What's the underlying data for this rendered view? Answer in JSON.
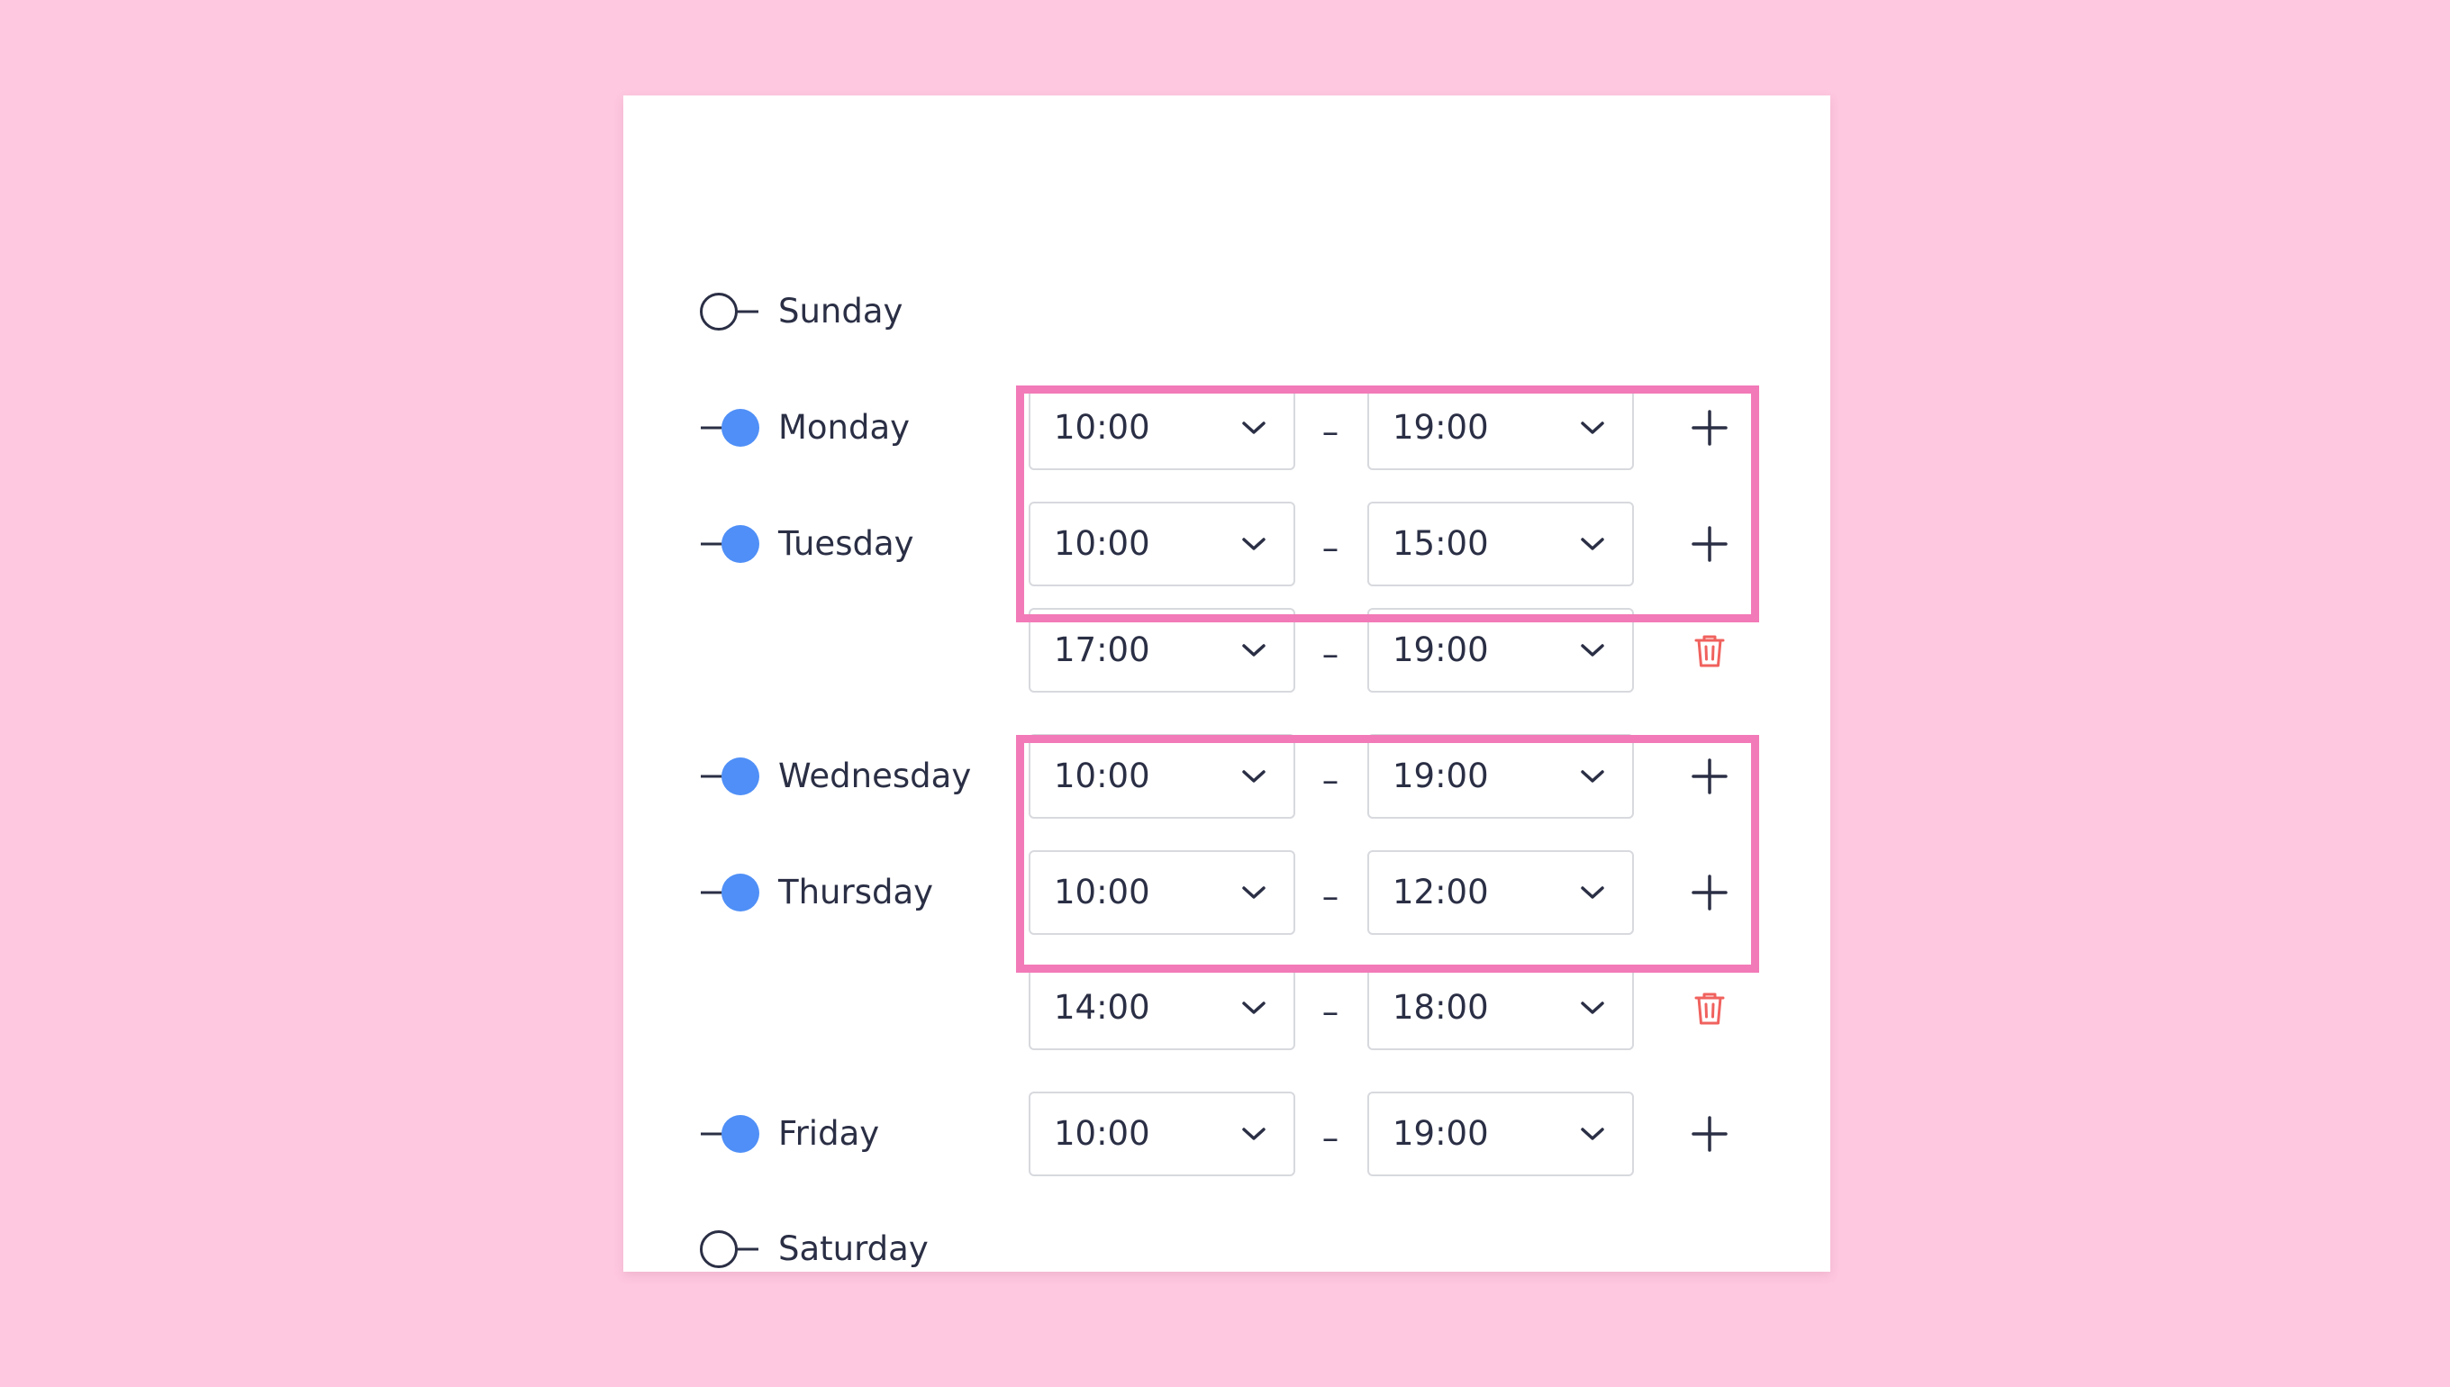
{
  "schedule": {
    "days": [
      {
        "label": "Sunday",
        "enabled": false,
        "slots": []
      },
      {
        "label": "Monday",
        "enabled": true,
        "slots": [
          {
            "start": "10:00",
            "end": "19:00"
          }
        ]
      },
      {
        "label": "Tuesday",
        "enabled": true,
        "slots": [
          {
            "start": "10:00",
            "end": "15:00"
          },
          {
            "start": "17:00",
            "end": "19:00"
          }
        ]
      },
      {
        "label": "Wednesday",
        "enabled": true,
        "slots": [
          {
            "start": "10:00",
            "end": "19:00"
          }
        ]
      },
      {
        "label": "Thursday",
        "enabled": true,
        "slots": [
          {
            "start": "10:00",
            "end": "12:00"
          },
          {
            "start": "14:00",
            "end": "18:00"
          }
        ]
      },
      {
        "label": "Friday",
        "enabled": true,
        "slots": [
          {
            "start": "10:00",
            "end": "19:00"
          }
        ]
      },
      {
        "label": "Saturday",
        "enabled": false,
        "slots": []
      }
    ],
    "separator": "–",
    "highlighted_days": [
      "Tuesday",
      "Thursday"
    ]
  },
  "icons": {
    "add": "plus-icon",
    "remove": "trash-icon",
    "dropdown": "chevron-down-icon",
    "toggle_on": "toggle-on-icon",
    "toggle_off": "toggle-off-icon"
  },
  "colors": {
    "background": "#fec8e0",
    "card": "#ffffff",
    "toggle_on": "#4f8ff7",
    "highlight": "#f27ab8",
    "delete": "#f0625e",
    "text": "#2b2f45"
  }
}
